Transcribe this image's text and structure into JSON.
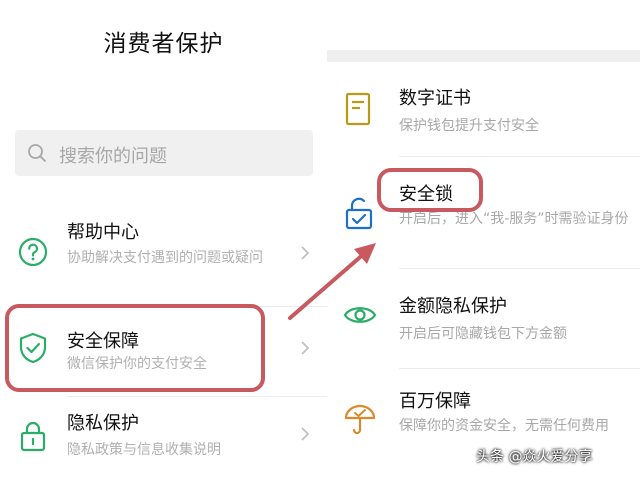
{
  "left": {
    "title": "消费者保护",
    "search_placeholder": "搜索你的问题",
    "items": [
      {
        "title": "帮助中心",
        "subtitle": "协助解决支付遇到的问题或疑问",
        "icon": "question-circle-icon"
      },
      {
        "title": "安全保障",
        "subtitle": "微信保护你的支付安全",
        "icon": "shield-check-icon"
      },
      {
        "title": "隐私保护",
        "subtitle": "隐私政策与信息收集说明",
        "icon": "padlock-icon"
      }
    ]
  },
  "right": {
    "items": [
      {
        "title": "数字证书",
        "subtitle": "保护钱包提升支付安全",
        "icon": "certificate-icon"
      },
      {
        "title": "安全锁",
        "subtitle": "开启后，进入“我-服务”时需验证身份",
        "icon": "security-lock-icon"
      },
      {
        "title": "金额隐私保护",
        "subtitle": "开启后可隐藏钱包下方金额",
        "icon": "eye-icon"
      },
      {
        "title": "百万保障",
        "subtitle": "保障你的资金安全，无需任何费用",
        "icon": "umbrella-icon"
      }
    ]
  },
  "watermark": "头条 @焱火爱分享",
  "colors": {
    "icon_green": "#2aae67",
    "icon_blue": "#1e6fc9",
    "icon_gold": "#b89a18",
    "icon_orange": "#d98a2b",
    "annotation_red": "#c8595f"
  }
}
